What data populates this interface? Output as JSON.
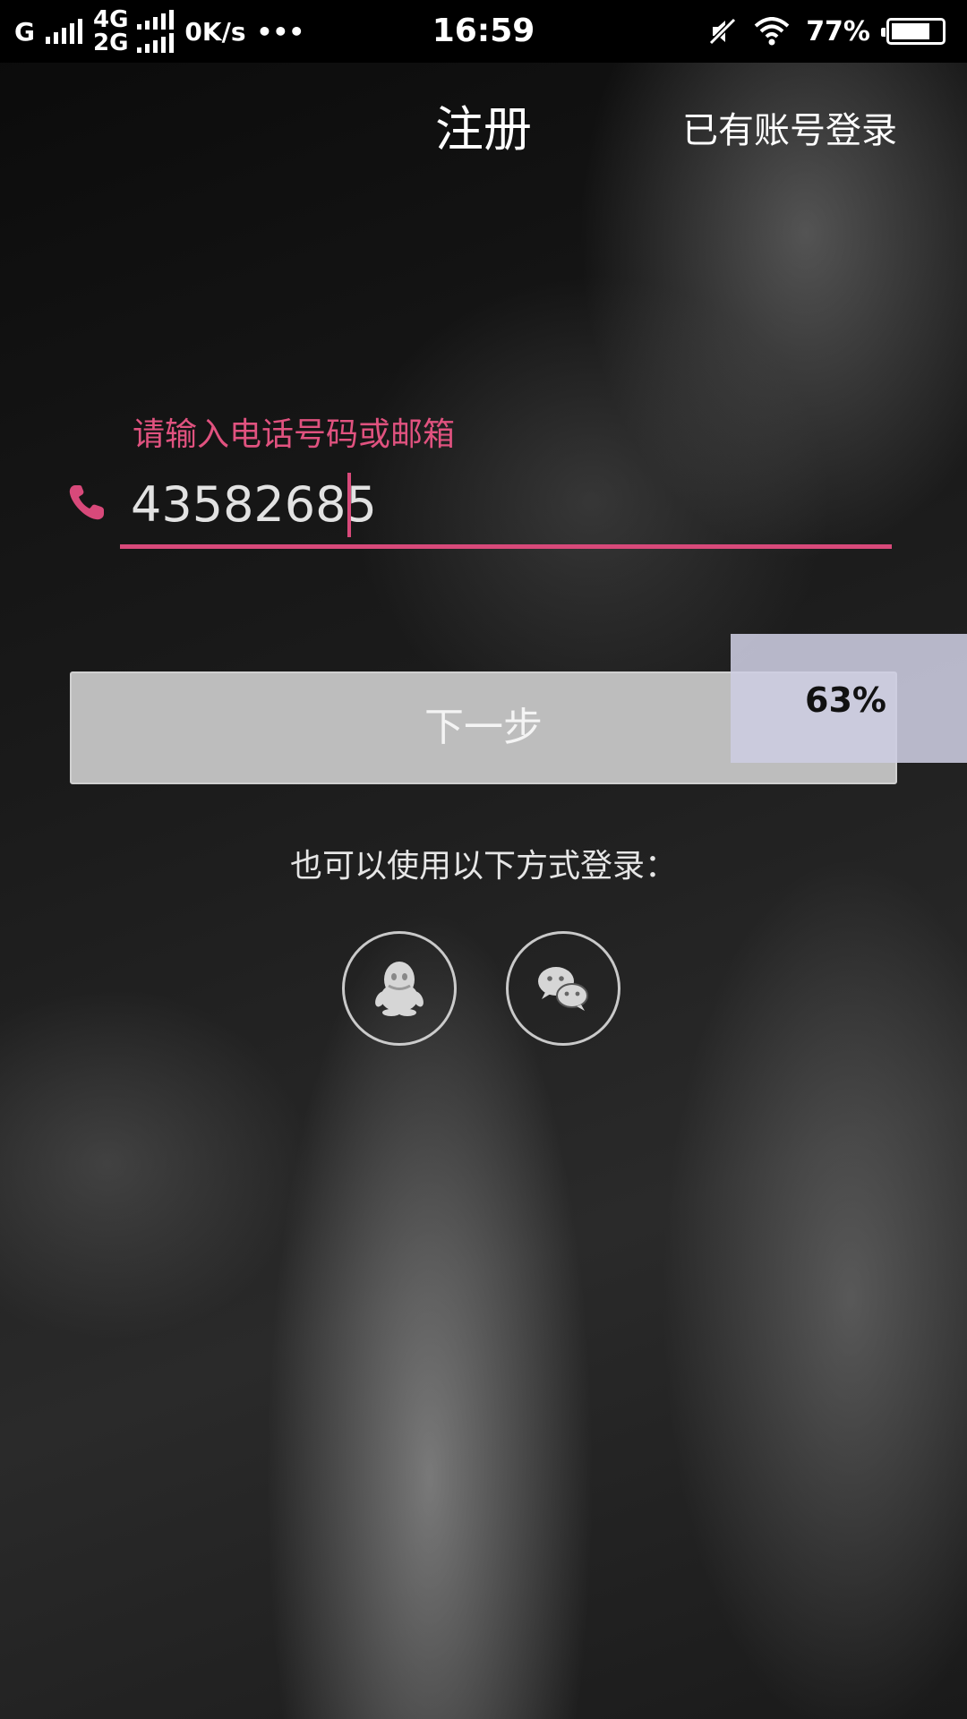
{
  "status_bar": {
    "carrier_1": "G",
    "carrier_2_top": "4G",
    "carrier_2_bottom": "2G",
    "speed": "0K/s",
    "more": "•••",
    "time": "16:59",
    "battery_percent": "77%",
    "battery_level": 0.77
  },
  "header": {
    "title": "注册",
    "login_link": "已有账号登录"
  },
  "form": {
    "hint": "请输入电话号码或邮箱",
    "phone_value": "43582685",
    "accent_color": "#d8497a"
  },
  "next_button": {
    "label": "下一步"
  },
  "progress": {
    "text": "63%",
    "value": 0.63
  },
  "alternate_login": {
    "label": "也可以使用以下方式登录：",
    "options": [
      {
        "icon": "qq-icon"
      },
      {
        "icon": "wechat-icon"
      }
    ]
  }
}
